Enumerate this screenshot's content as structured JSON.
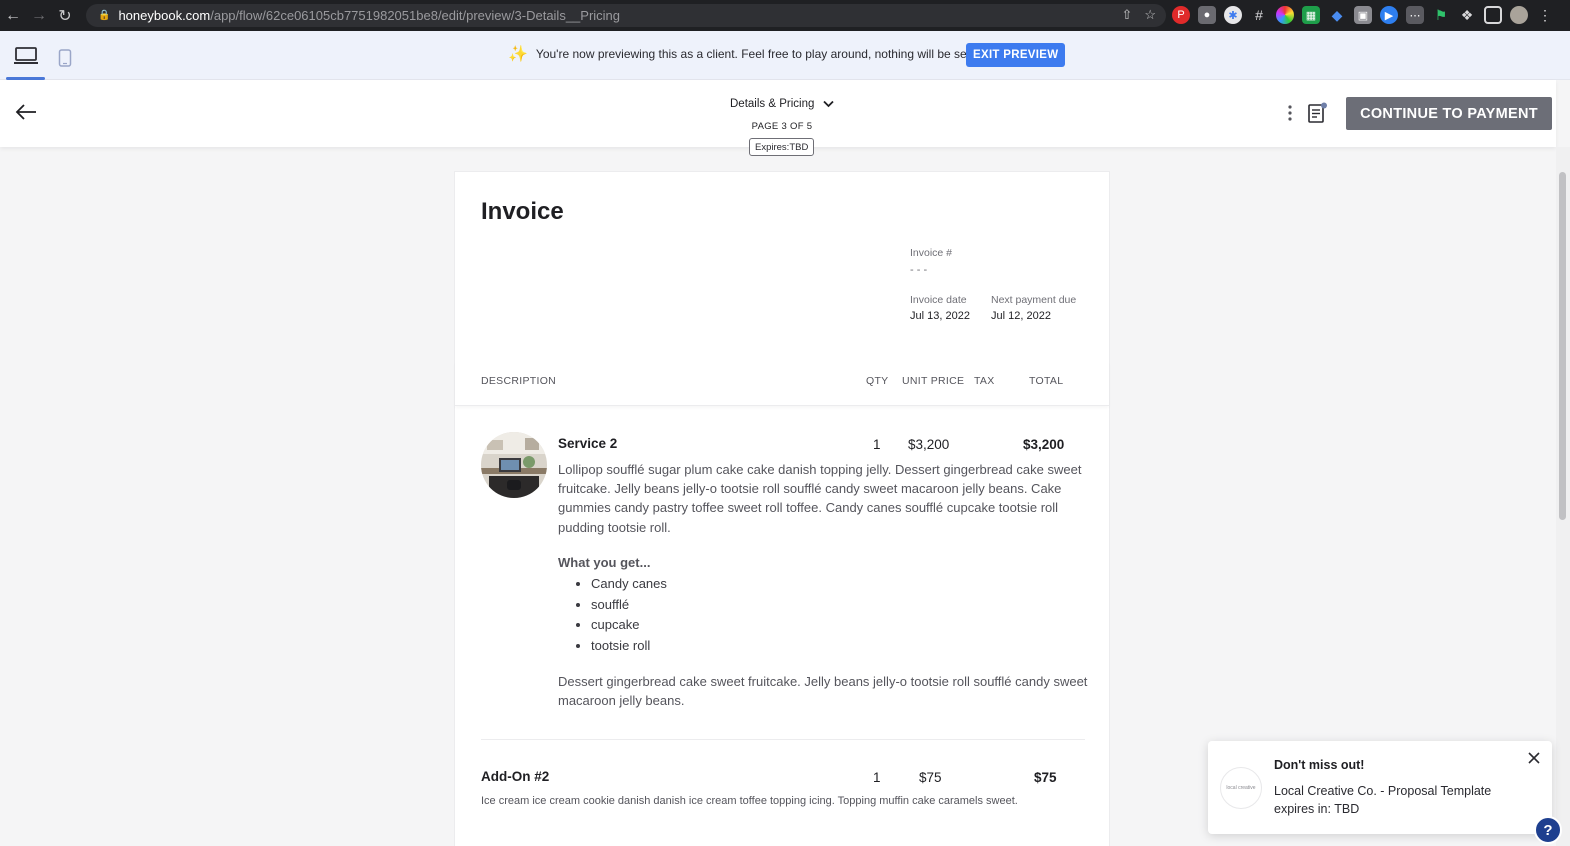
{
  "browser": {
    "url_host": "honeybook.com",
    "url_path": "/app/flow/62ce06105cb7751982051be8/edit/preview/3-Details__Pricing"
  },
  "preview_banner": {
    "message": "You're now previewing this as a client. Feel free to play around, nothing will be sent!",
    "exit_label": "EXIT PREVIEW"
  },
  "header": {
    "page_name": "Details & Pricing",
    "page_count": "PAGE 3 OF 5",
    "expires": "Expires:TBD",
    "continue_label": "CONTINUE TO PAYMENT"
  },
  "invoice": {
    "title": "Invoice",
    "number_label": "Invoice #",
    "number_value": "- - -",
    "date_label": "Invoice date",
    "date_value": "Jul 13, 2022",
    "due_label": "Next payment due",
    "due_value": "Jul 12, 2022",
    "columns": {
      "description": "DESCRIPTION",
      "qty": "QTY",
      "unit_price": "UNIT PRICE",
      "tax": "TAX",
      "total": "TOTAL"
    },
    "items": [
      {
        "name": "Service 2",
        "qty": "1",
        "unit_price": "$3,200",
        "total": "$3,200",
        "description": "Lollipop soufflé sugar plum cake cake danish topping jelly. Dessert gingerbread cake sweet fruitcake. Jelly beans jelly-o tootsie roll soufflé candy sweet macaroon jelly beans. Cake gummies candy pastry toffee sweet roll toffee. Candy canes soufflé cupcake tootsie roll pudding tootsie roll.",
        "what_title": "What you get...",
        "bullets": [
          "Candy canes",
          "soufflé",
          "cupcake",
          "tootsie roll"
        ],
        "footer": "Dessert gingerbread cake sweet fruitcake. Jelly beans jelly-o tootsie roll soufflé candy sweet macaroon jelly beans."
      },
      {
        "name": "Add-On #2",
        "qty": "1",
        "unit_price": "$75",
        "total": "$75",
        "description": "Ice cream ice cream cookie danish danish ice cream toffee topping icing. Topping muffin cake caramels sweet."
      }
    ]
  },
  "toast": {
    "title": "Don't miss out!",
    "body": "Local Creative Co. - Proposal Template expires in: TBD",
    "logo_text": "local creative"
  },
  "help": {
    "label": "?"
  },
  "colors": {
    "accent": "#3d7bef",
    "continue_bg": "#6c6e77",
    "help_bg": "#1e3f8f"
  }
}
